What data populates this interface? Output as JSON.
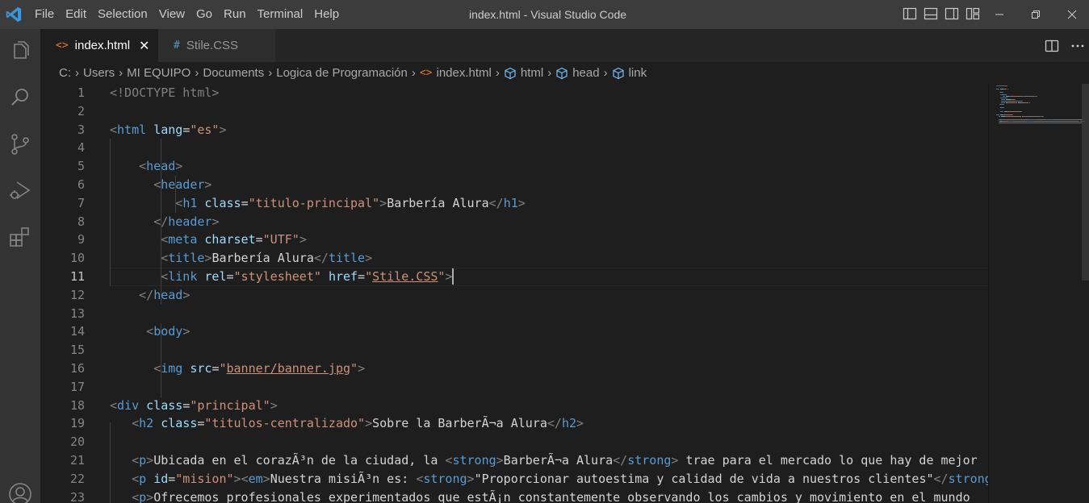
{
  "titlebar": {
    "menu": [
      "File",
      "Edit",
      "Selection",
      "View",
      "Go",
      "Run",
      "Terminal",
      "Help"
    ],
    "title": "index.html - Visual Studio Code",
    "logo_icon": "vscode-logo-icon",
    "layout_icons": [
      "toggle-primary-sidebar-icon",
      "toggle-panel-icon",
      "toggle-secondary-sidebar-icon",
      "customize-layout-icon"
    ],
    "window_controls": [
      "minimize-icon",
      "restore-icon",
      "close-icon"
    ]
  },
  "activitybar": {
    "items": [
      "explorer-icon",
      "search-icon",
      "source-control-icon",
      "run-debug-icon",
      "extensions-icon",
      "accounts-icon"
    ]
  },
  "tabs": [
    {
      "label": "index.html",
      "icon": "<>",
      "icon_color": "#e37933",
      "active": true
    },
    {
      "label": "Stile.CSS",
      "icon": "#",
      "icon_color": "#519aba",
      "active": false
    }
  ],
  "tab_actions": [
    "split-editor-icon",
    "more-actions-icon"
  ],
  "breadcrumb": [
    {
      "label": "C:"
    },
    {
      "label": "Users"
    },
    {
      "label": "MI EQUIPO"
    },
    {
      "label": "Documents"
    },
    {
      "label": "Logica de Programación"
    },
    {
      "label": "index.html",
      "icon": "<>"
    },
    {
      "label": "html",
      "icon": "symbol"
    },
    {
      "label": "head",
      "icon": "symbol"
    },
    {
      "label": "link",
      "icon": "symbol"
    }
  ],
  "editor": {
    "current_line": 11,
    "lines": [
      {
        "n": "1",
        "tokens": [
          [
            "p",
            "<!DOCTYPE html>"
          ]
        ]
      },
      {
        "n": "2",
        "tokens": []
      },
      {
        "n": "3",
        "tokens": [
          [
            "p",
            "<"
          ],
          [
            "t",
            "html"
          ],
          [
            "x",
            " "
          ],
          [
            "a",
            "lang"
          ],
          [
            "x",
            "="
          ],
          [
            "s",
            "\"es\""
          ],
          [
            "p",
            ">"
          ]
        ]
      },
      {
        "n": "4",
        "tokens": []
      },
      {
        "n": "5",
        "tokens": [
          [
            "x",
            "    "
          ],
          [
            "p",
            "<"
          ],
          [
            "t",
            "head"
          ],
          [
            "p",
            ">"
          ]
        ]
      },
      {
        "n": "6",
        "tokens": [
          [
            "x",
            "      "
          ],
          [
            "p",
            "<"
          ],
          [
            "t",
            "header"
          ],
          [
            "p",
            ">"
          ]
        ]
      },
      {
        "n": "7",
        "tokens": [
          [
            "x",
            "         "
          ],
          [
            "p",
            "<"
          ],
          [
            "t",
            "h1"
          ],
          [
            "x",
            " "
          ],
          [
            "a",
            "class"
          ],
          [
            "x",
            "="
          ],
          [
            "s",
            "\"titulo-principal\""
          ],
          [
            "p",
            ">"
          ],
          [
            "x",
            "Barbería Alura"
          ],
          [
            "p",
            "</"
          ],
          [
            "t",
            "h1"
          ],
          [
            "p",
            ">"
          ]
        ]
      },
      {
        "n": "8",
        "tokens": [
          [
            "x",
            "      "
          ],
          [
            "p",
            "</"
          ],
          [
            "t",
            "header"
          ],
          [
            "p",
            ">"
          ]
        ]
      },
      {
        "n": "9",
        "tokens": [
          [
            "x",
            "       "
          ],
          [
            "p",
            "<"
          ],
          [
            "t",
            "meta"
          ],
          [
            "x",
            " "
          ],
          [
            "a",
            "charset"
          ],
          [
            "x",
            "="
          ],
          [
            "s",
            "\"UTF\""
          ],
          [
            "p",
            ">"
          ]
        ]
      },
      {
        "n": "10",
        "tokens": [
          [
            "x",
            "       "
          ],
          [
            "p",
            "<"
          ],
          [
            "t",
            "title"
          ],
          [
            "p",
            ">"
          ],
          [
            "x",
            "Barbería Alura"
          ],
          [
            "p",
            "</"
          ],
          [
            "t",
            "title"
          ],
          [
            "p",
            ">"
          ]
        ]
      },
      {
        "n": "11",
        "tokens": [
          [
            "x",
            "       "
          ],
          [
            "p",
            "<"
          ],
          [
            "t",
            "link"
          ],
          [
            "x",
            " "
          ],
          [
            "a",
            "rel"
          ],
          [
            "x",
            "="
          ],
          [
            "s",
            "\"stylesheet\""
          ],
          [
            "x",
            " "
          ],
          [
            "a",
            "href"
          ],
          [
            "x",
            "="
          ],
          [
            "s",
            "\""
          ],
          [
            "su",
            "Stile.CSS"
          ],
          [
            "s",
            "\""
          ],
          [
            "p",
            ">"
          ]
        ]
      },
      {
        "n": "12",
        "tokens": [
          [
            "x",
            "    "
          ],
          [
            "p",
            "</"
          ],
          [
            "t",
            "head"
          ],
          [
            "p",
            ">"
          ]
        ]
      },
      {
        "n": "13",
        "tokens": []
      },
      {
        "n": "14",
        "tokens": [
          [
            "x",
            "     "
          ],
          [
            "p",
            "<"
          ],
          [
            "t",
            "body"
          ],
          [
            "p",
            ">"
          ]
        ]
      },
      {
        "n": "15",
        "tokens": []
      },
      {
        "n": "16",
        "tokens": [
          [
            "x",
            "      "
          ],
          [
            "p",
            "<"
          ],
          [
            "t",
            "img"
          ],
          [
            "x",
            " "
          ],
          [
            "a",
            "src"
          ],
          [
            "x",
            "="
          ],
          [
            "s",
            "\""
          ],
          [
            "su",
            "banner/banner.jpg"
          ],
          [
            "s",
            "\""
          ],
          [
            "p",
            ">"
          ]
        ]
      },
      {
        "n": "17",
        "tokens": []
      },
      {
        "n": "18",
        "tokens": [
          [
            "p",
            "<"
          ],
          [
            "t",
            "div"
          ],
          [
            "x",
            " "
          ],
          [
            "a",
            "class"
          ],
          [
            "x",
            "="
          ],
          [
            "s",
            "\"principal\""
          ],
          [
            "p",
            ">"
          ]
        ]
      },
      {
        "n": "19",
        "tokens": [
          [
            "x",
            "   "
          ],
          [
            "p",
            "<"
          ],
          [
            "t",
            "h2"
          ],
          [
            "x",
            " "
          ],
          [
            "a",
            "class"
          ],
          [
            "x",
            "="
          ],
          [
            "s",
            "\"titulos-centralizado\""
          ],
          [
            "p",
            ">"
          ],
          [
            "x",
            "Sobre la BarberÃ¬a Alura"
          ],
          [
            "p",
            "</"
          ],
          [
            "t",
            "h2"
          ],
          [
            "p",
            ">"
          ]
        ]
      },
      {
        "n": "20",
        "tokens": []
      },
      {
        "n": "21",
        "tokens": [
          [
            "x",
            "   "
          ],
          [
            "p",
            "<"
          ],
          [
            "t",
            "p"
          ],
          [
            "p",
            ">"
          ],
          [
            "x",
            "Ubicada en el corazÃ³n de la ciudad, la "
          ],
          [
            "p",
            "<"
          ],
          [
            "t",
            "strong"
          ],
          [
            "p",
            ">"
          ],
          [
            "x",
            "BarberÃ¬a Alura"
          ],
          [
            "p",
            "</"
          ],
          [
            "t",
            "strong"
          ],
          [
            "p",
            ">"
          ],
          [
            "x",
            " trae para el mercado lo que hay de mejor"
          ]
        ]
      },
      {
        "n": "22",
        "tokens": [
          [
            "x",
            "   "
          ],
          [
            "p",
            "<"
          ],
          [
            "t",
            "p"
          ],
          [
            "x",
            " "
          ],
          [
            "a",
            "id"
          ],
          [
            "x",
            "="
          ],
          [
            "s",
            "\"mision\""
          ],
          [
            "p",
            ">"
          ],
          [
            "p",
            "<"
          ],
          [
            "t",
            "em"
          ],
          [
            "p",
            ">"
          ],
          [
            "x",
            "Nuestra misiÃ³n es: "
          ],
          [
            "p",
            "<"
          ],
          [
            "t",
            "strong"
          ],
          [
            "p",
            ">"
          ],
          [
            "x",
            "\"Proporcionar autoestima y calidad de vida a nuestros clientes\""
          ],
          [
            "p",
            "</"
          ],
          [
            "t",
            "strong"
          ],
          [
            "p",
            ">"
          ]
        ]
      },
      {
        "n": "23",
        "tokens": [
          [
            "x",
            "   "
          ],
          [
            "p",
            "<"
          ],
          [
            "t",
            "p"
          ],
          [
            "p",
            ">"
          ],
          [
            "x",
            "Ofrecemos profesionales experimentados que estÃ¡n constantemente observando los cambios y movimiento en el mundo"
          ]
        ]
      }
    ]
  }
}
